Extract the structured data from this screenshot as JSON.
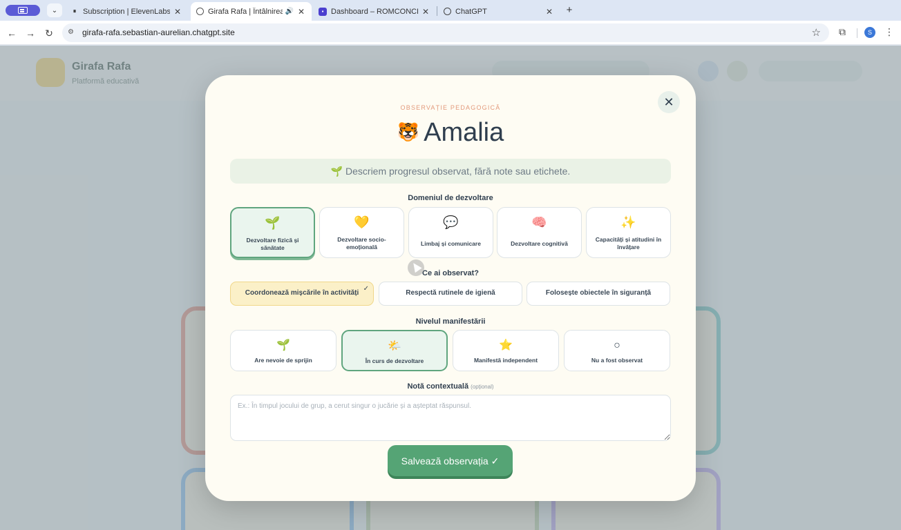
{
  "browser": {
    "tabs": [
      {
        "title": "Subscription | ElevenLabs",
        "favicon": "pause-icon",
        "active": false
      },
      {
        "title": "Girafa Rafa | Întâlnirea de",
        "favicon": "globe-icon",
        "active": true,
        "audio": true
      },
      {
        "title": "Dashboard – ROMCONCEPT",
        "favicon": "chat-bubble-icon",
        "active": false
      },
      {
        "title": "ChatGPT",
        "favicon": "openai-icon",
        "active": false
      }
    ],
    "url": "girafa-rafa.sebastian-aurelian.chatgpt.site",
    "profile_initial": "S"
  },
  "modal": {
    "eyebrow": "OBSERVAȚIE PEDAGOGICĂ",
    "child_emoji": "🐯",
    "child_name": "Amalia",
    "hint": "🌱 Descriem progresul observat, fără note sau etichete.",
    "domain_section": "Domeniul de dezvoltare",
    "domains": [
      {
        "icon": "🌱",
        "label": "Dezvoltare fizică și sănătate",
        "selected": true
      },
      {
        "icon": "💛",
        "label": "Dezvoltare socio-emoțională",
        "selected": false
      },
      {
        "icon": "💬",
        "label": "Limbaj și comunicare",
        "selected": false
      },
      {
        "icon": "🧠",
        "label": "Dezvoltare cognitivă",
        "selected": false
      },
      {
        "icon": "✨",
        "label": "Capacități și atitudini în învățare",
        "selected": false
      }
    ],
    "observed_section": "Ce ai observat?",
    "observations": [
      {
        "label": "Coordonează mișcările în activități",
        "selected": true
      },
      {
        "label": "Respectă rutinele de igienă",
        "selected": false
      },
      {
        "label": "Folosește obiectele în siguranță",
        "selected": false
      }
    ],
    "check_mark": "✓",
    "level_section": "Nivelul manifestării",
    "levels": [
      {
        "icon": "🌱",
        "label": "Are nevoie de sprijin",
        "selected": false
      },
      {
        "icon": "🌤️",
        "label": "În curs de dezvoltare",
        "selected": true
      },
      {
        "icon": "⭐",
        "label": "Manifestă independent",
        "selected": false
      },
      {
        "icon": "○",
        "label": "Nu a fost observat",
        "selected": false
      }
    ],
    "note_section": "Notă contextuală",
    "note_optional": "(opțional)",
    "note_placeholder": "Ex.: În timpul jocului de grup, a cerut singur o jucărie și a așteptat răspunsul.",
    "note_value": "",
    "save_label": "Salvează observația ✓",
    "close_glyph": "✕"
  },
  "background_app": {
    "brand": "Girafa Rafa",
    "brand_sub": "Platformă educativă"
  },
  "colors": {
    "accent_green": "#55a475",
    "selected_yellow": "#fbf0c8",
    "eyebrow_coral": "#e39a7c",
    "modal_bg": "#fefcf3"
  }
}
